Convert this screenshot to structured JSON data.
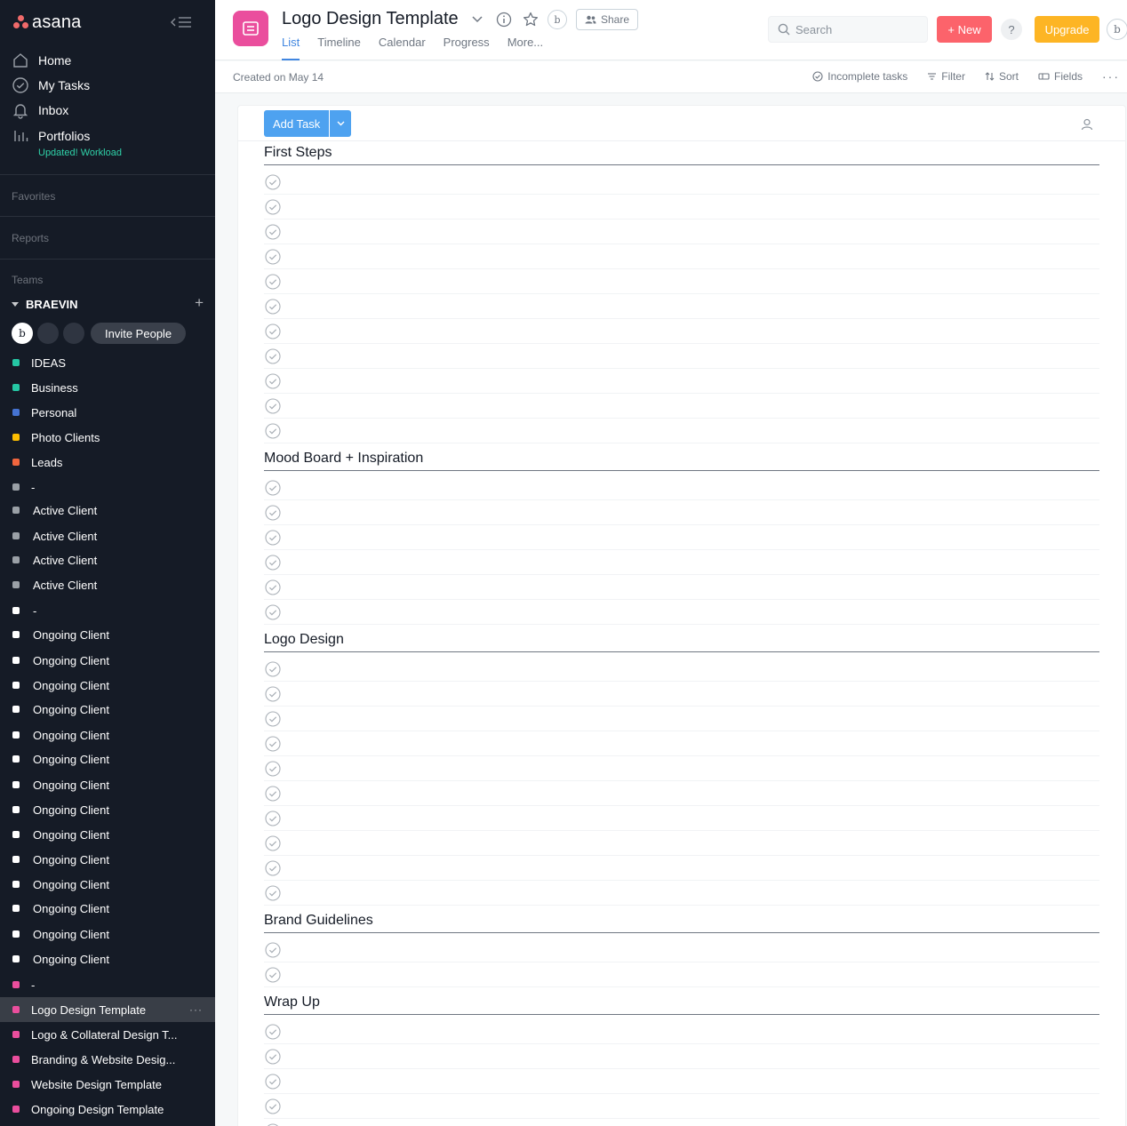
{
  "sidebar": {
    "logo_text": "asana",
    "nav": [
      {
        "label": "Home",
        "icon": "home-icon"
      },
      {
        "label": "My Tasks",
        "icon": "check-circle-icon"
      },
      {
        "label": "Inbox",
        "icon": "bell-icon"
      },
      {
        "label": "Portfolios",
        "icon": "bar-chart-icon"
      }
    ],
    "portfolios_sub": "Updated! Workload",
    "sections": [
      "Favorites",
      "Reports",
      "Teams"
    ],
    "team_name": "BRAEVIN",
    "member_initial": "b",
    "invite_label": "Invite People",
    "projects": [
      {
        "label": "IDEAS",
        "color": "#25c7a4"
      },
      {
        "label": "Business",
        "color": "#25c7a4"
      },
      {
        "label": "Personal",
        "color": "#4573d2"
      },
      {
        "label": "Photo Clients",
        "color": "#fcbd01"
      },
      {
        "label": "Leads",
        "color": "#f0663e"
      },
      {
        "label": "-",
        "color": "#9aa0a6"
      },
      {
        "label": "Active Client",
        "color": "#9aa0a6"
      },
      {
        "label": "Active Client",
        "color": "#9aa0a6"
      },
      {
        "label": "Active Client",
        "color": "#9aa0a6"
      },
      {
        "label": "Active Client",
        "color": "#9aa0a6"
      },
      {
        "label": "-",
        "color": "#ffffff"
      },
      {
        "label": "Ongoing Client",
        "color": "#ffffff"
      },
      {
        "label": "Ongoing Client",
        "color": "#ffffff"
      },
      {
        "label": "Ongoing Client",
        "color": "#ffffff"
      },
      {
        "label": "Ongoing Client",
        "color": "#ffffff"
      },
      {
        "label": "Ongoing Client",
        "color": "#ffffff"
      },
      {
        "label": "Ongoing Client",
        "color": "#ffffff"
      },
      {
        "label": "Ongoing Client",
        "color": "#ffffff"
      },
      {
        "label": "Ongoing Client",
        "color": "#ffffff"
      },
      {
        "label": "Ongoing Client",
        "color": "#ffffff"
      },
      {
        "label": "Ongoing Client",
        "color": "#ffffff"
      },
      {
        "label": "Ongoing Client",
        "color": "#ffffff"
      },
      {
        "label": "Ongoing Client",
        "color": "#ffffff"
      },
      {
        "label": "Ongoing Client",
        "color": "#ffffff"
      },
      {
        "label": "Ongoing Client",
        "color": "#ffffff"
      },
      {
        "label": "-",
        "color": "#ea4e9d"
      },
      {
        "label": "Logo Design Template",
        "color": "#ea4e9d",
        "active": true
      },
      {
        "label": "Logo & Collateral Design T...",
        "color": "#ea4e9d"
      },
      {
        "label": "Branding & Website Desig...",
        "color": "#ea4e9d"
      },
      {
        "label": "Website Design Template",
        "color": "#ea4e9d"
      },
      {
        "label": "Ongoing Design Template",
        "color": "#ea4e9d"
      }
    ],
    "active_more": "···"
  },
  "header": {
    "project_title": "Logo Design Template",
    "project_color": "#ea4e9d",
    "avatar_initial": "b",
    "share_label": "Share",
    "tabs": [
      "List",
      "Timeline",
      "Calendar",
      "Progress",
      "More..."
    ],
    "active_tab": "List",
    "search_placeholder": "Search",
    "new_label": "+ New",
    "help_label": "?",
    "upgrade_label": "Upgrade",
    "user_initial": "b"
  },
  "toolbar": {
    "created": "Created on May 14",
    "incomplete": "Incomplete tasks",
    "filter": "Filter",
    "sort": "Sort",
    "fields": "Fields",
    "more": "···"
  },
  "list": {
    "add_task_label": "Add Task",
    "sections": [
      {
        "title": "First Steps",
        "task_count": 11
      },
      {
        "title": "Mood Board + Inspiration",
        "task_count": 6
      },
      {
        "title": "Logo Design",
        "task_count": 10
      },
      {
        "title": "Brand Guidelines",
        "task_count": 2
      },
      {
        "title": "Wrap Up",
        "task_count": 6
      }
    ]
  }
}
